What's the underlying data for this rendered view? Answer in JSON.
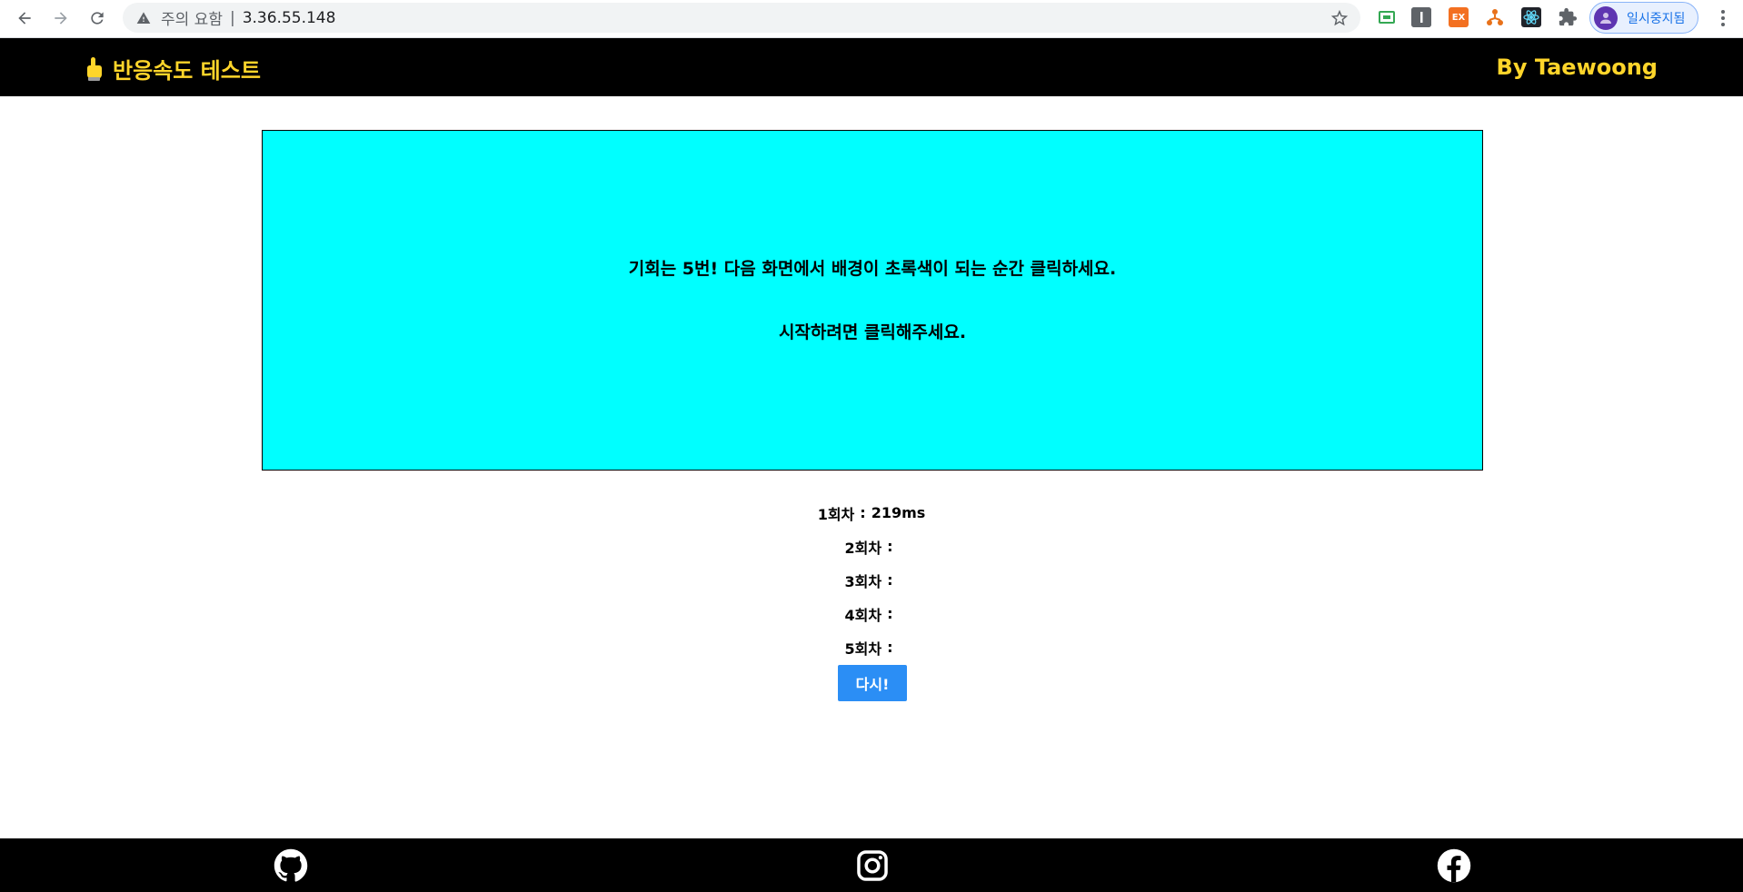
{
  "browser": {
    "security_label": "주의 요함",
    "separator": "|",
    "url": "3.36.55.148",
    "extension_3_label": "EX",
    "profile_label": "일시중지됨",
    "icons": [
      "back-arrow-icon",
      "forward-arrow-icon",
      "reload-icon",
      "warning-icon",
      "star-icon",
      "extension-puzzle-icon",
      "more-vert-icon"
    ]
  },
  "header": {
    "title": "반응속도 테스트",
    "author": "By Taewoong",
    "accent_color": "#ffd52a",
    "icon": "pointing-hand-icon"
  },
  "stage": {
    "line1": "기회는 5번! 다음 화면에서 배경이 초록색이 되는 순간 클릭하세요.",
    "line2": "시작하려면 클릭해주세요.",
    "background_color": "#00ffff"
  },
  "results": [
    {
      "label": "1회차",
      "separator": ":",
      "value": "219ms"
    },
    {
      "label": "2회차",
      "separator": ":",
      "value": ""
    },
    {
      "label": "3회차",
      "separator": ":",
      "value": ""
    },
    {
      "label": "4회차",
      "separator": ":",
      "value": ""
    },
    {
      "label": "5회차",
      "separator": ":",
      "value": ""
    }
  ],
  "retry_button": {
    "label": "다시!",
    "color": "#2b8ef5"
  },
  "footer": {
    "icons": [
      "github-icon",
      "instagram-icon",
      "facebook-icon"
    ]
  }
}
